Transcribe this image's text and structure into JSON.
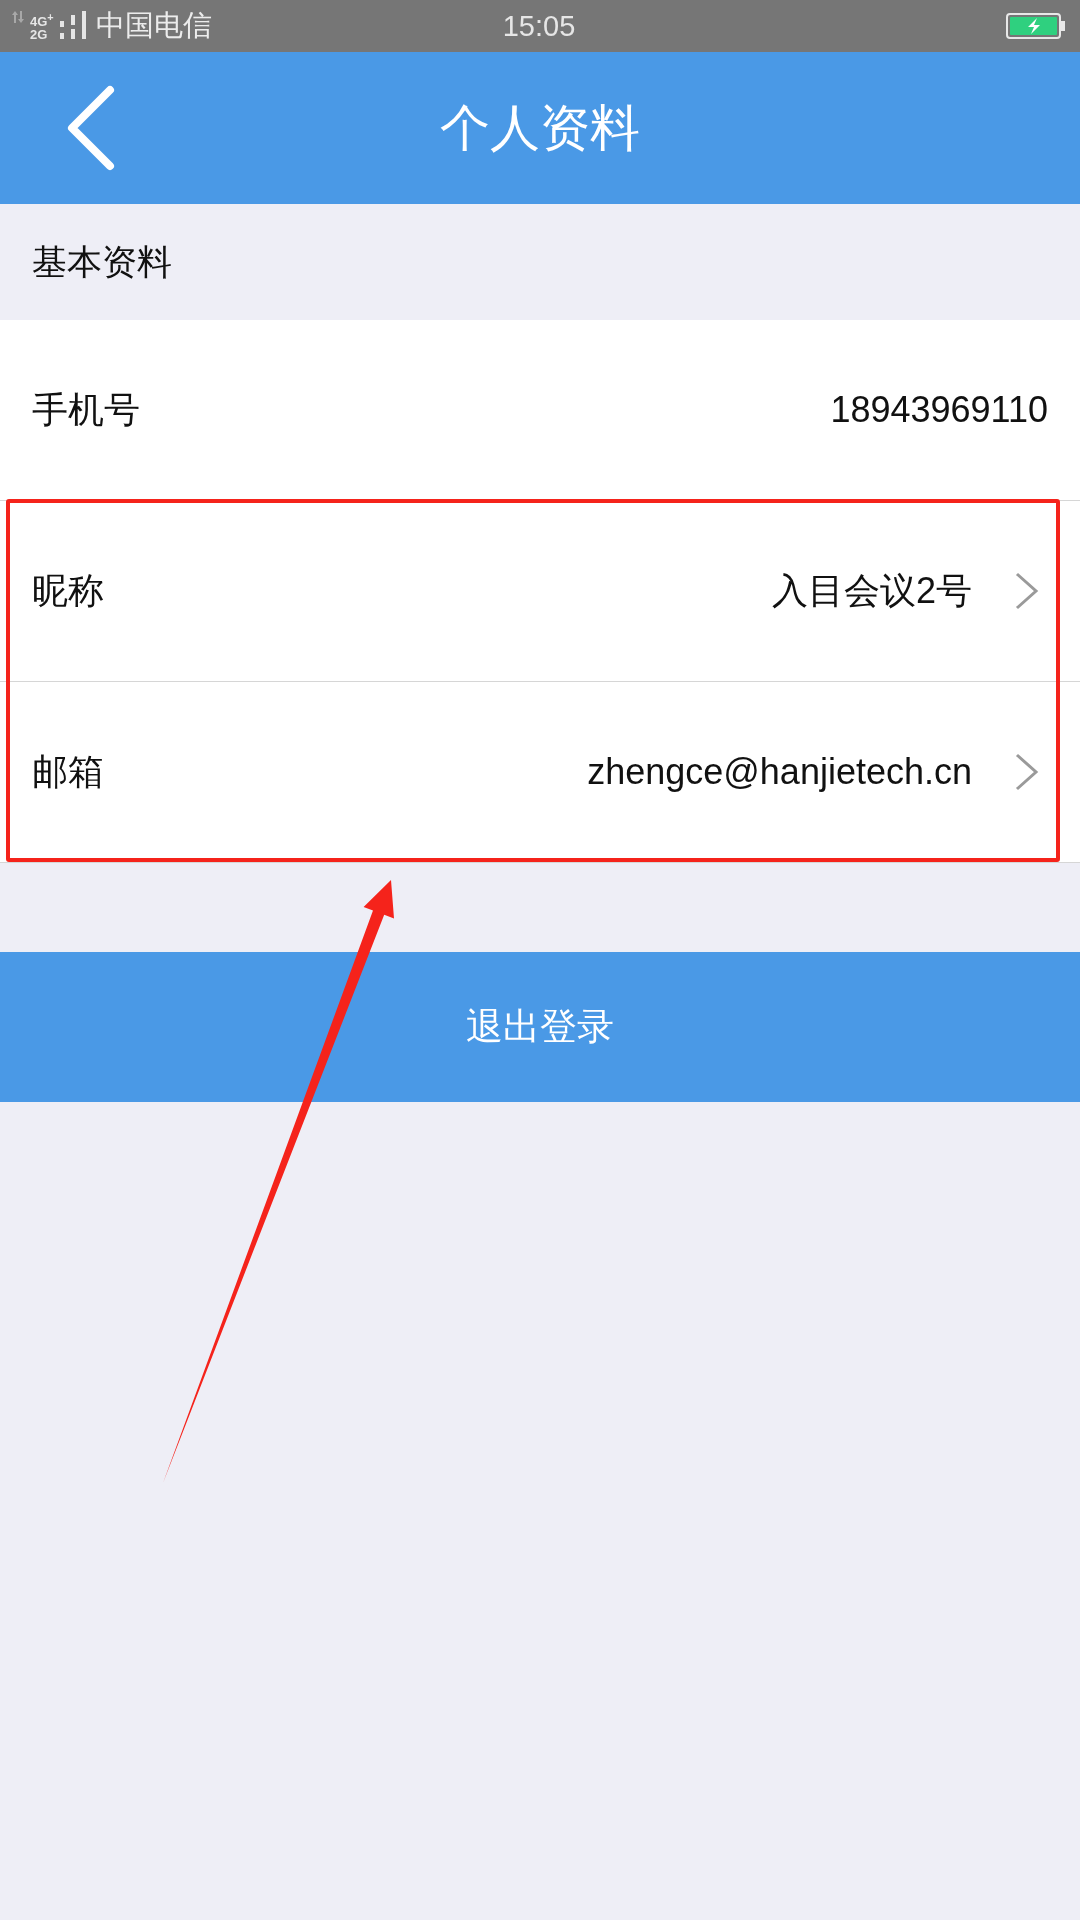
{
  "status_bar": {
    "network_top": "4G$^{+}$",
    "network_bottom": "2G",
    "carrier": "中国电信",
    "time": "15:05"
  },
  "nav_bar": {
    "title": "个人资料"
  },
  "section": {
    "title": "基本资料"
  },
  "rows": [
    {
      "label": "手机号",
      "value": "18943969110",
      "kind": "plain",
      "highlighted": false
    },
    {
      "label": "昵称",
      "value": "入目会议2号",
      "kind": "link",
      "highlighted": true
    },
    {
      "label": "邮箱",
      "value": "zhengce@hanjietech.cn",
      "kind": "link",
      "highlighted": true
    }
  ],
  "logout_button": {
    "label": "退出登录"
  },
  "pointer_arrow": true
}
